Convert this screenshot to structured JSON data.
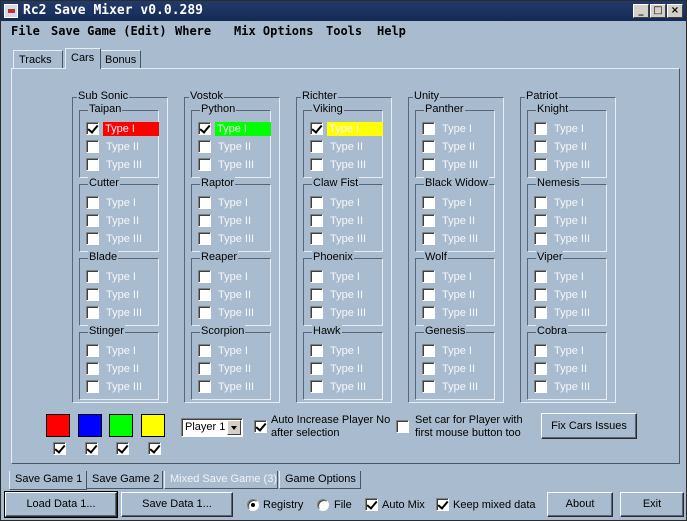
{
  "window": {
    "title": "Rc2 Save Mixer v0.0.289",
    "controls": {
      "minimize": "_",
      "maximize": "□",
      "close": "×"
    }
  },
  "menu": [
    "File",
    "Save Game (Edit)",
    "Where",
    "Mix Options",
    "Tools",
    "Help"
  ],
  "top_tabs": [
    "Tracks",
    "Cars",
    "Bonus"
  ],
  "active_top_tab": "Cars",
  "type_labels": [
    "Type I",
    "Type II",
    "Type III"
  ],
  "manufacturers": [
    {
      "name": "Sub Sonic",
      "cars": [
        "Taipan",
        "Cutter",
        "Blade",
        "Stinger"
      ]
    },
    {
      "name": "Vostok",
      "cars": [
        "Python",
        "Raptor",
        "Reaper",
        "Scorpion"
      ]
    },
    {
      "name": "Richter",
      "cars": [
        "Viking",
        "Claw Fist",
        "Phoenix",
        "Hawk"
      ]
    },
    {
      "name": "Unity",
      "cars": [
        "Panther",
        "Black Widow",
        "Wolf",
        "Genesis"
      ]
    },
    {
      "name": "Patriot",
      "cars": [
        "Knight",
        "Nemesis",
        "Viper",
        "Cobra"
      ]
    }
  ],
  "selected_cars": [
    {
      "manufacturer": "Sub Sonic",
      "car": "Taipan",
      "type": "Type I",
      "color": "#ff0000"
    },
    {
      "manufacturer": "Vostok",
      "car": "Python",
      "type": "Type I",
      "color": "#00ff00"
    },
    {
      "manufacturer": "Richter",
      "car": "Viking",
      "type": "Type I",
      "color": "#ffff00"
    }
  ],
  "player_colors": [
    {
      "color": "#ff0000",
      "checked": true
    },
    {
      "color": "#0000ff",
      "checked": true
    },
    {
      "color": "#00ff00",
      "checked": true
    },
    {
      "color": "#ffff00",
      "checked": true
    }
  ],
  "player_select": {
    "value": "Player 1"
  },
  "auto_increase": {
    "label_line1": "Auto Increase Player No",
    "label_line2": "after selection",
    "checked": true
  },
  "set_car_mouse": {
    "label_line1": "Set car for Player with",
    "label_line2": "first mouse button too",
    "checked": false
  },
  "fix_cars_button": "Fix Cars Issues",
  "bottom_tabs": [
    {
      "label": "Save Game 1",
      "active": true,
      "disabled": false
    },
    {
      "label": "Save Game 2",
      "active": false,
      "disabled": false
    },
    {
      "label": "Mixed Save Game (3)",
      "active": false,
      "disabled": true
    },
    {
      "label": "Game Options",
      "active": false,
      "disabled": false
    }
  ],
  "status": {
    "load_button": "Load Data 1...",
    "save_button": "Save Data 1...",
    "registry_label": "Registry",
    "file_label": "File",
    "source_selected": "Registry",
    "auto_mix_label": "Auto Mix",
    "auto_mix_checked": true,
    "keep_mixed_label": "Keep mixed data",
    "keep_mixed_checked": true,
    "about_button": "About",
    "exit_button": "Exit"
  }
}
